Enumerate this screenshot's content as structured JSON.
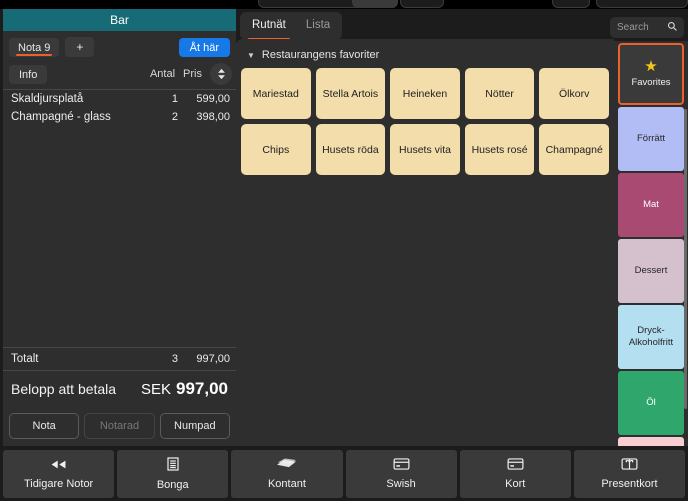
{
  "colors": {
    "header_teal": "#176b77",
    "accent_orange": "#e8622a",
    "primary_blue": "#1778e8",
    "product_tile": "#f2ddab",
    "panel": "#2e2e2e",
    "app_bg": "#1c1c1c"
  },
  "order": {
    "title": "Bar",
    "nota_label": "Nota 9",
    "add_label": "+",
    "eat_here_label": "Åt här",
    "info_label": "Info",
    "sort_icon": "sort-updown-icon",
    "col_qty": "Antal",
    "col_price": "Pris",
    "lines": [
      {
        "name": "Skaldjursplatå",
        "qty": "1",
        "price": "599,00"
      },
      {
        "name": "Champagné - glass",
        "qty": "2",
        "price": "398,00"
      }
    ],
    "total_label": "Totalt",
    "total_qty": "3",
    "total_price": "997,00",
    "amount_label": "Belopp att betala",
    "amount_currency": "SEK",
    "amount_value": "997,00",
    "buttons": [
      {
        "label": "Nota",
        "disabled": false
      },
      {
        "label": "Notarad",
        "disabled": true
      },
      {
        "label": "Numpad",
        "disabled": false
      }
    ]
  },
  "center": {
    "tabs": [
      {
        "label": "Rutnät",
        "active": true
      },
      {
        "label": "Lista",
        "active": false
      }
    ],
    "section_title": "Restaurangens favoriter",
    "caret_icon": "caret-down-icon",
    "products": [
      "Mariestad",
      "Stella Artois",
      "Heineken",
      "Nötter",
      "Ölkorv",
      "Chips",
      "Husets röda",
      "Husets vita",
      "Husets rosé",
      "Champagné"
    ]
  },
  "search": {
    "placeholder": "Search",
    "icon": "search-icon"
  },
  "categories": [
    {
      "label": "Favorites",
      "color": "#3a3a3a",
      "text": "#efefef",
      "selected": true,
      "icon": "star-icon"
    },
    {
      "label": "Förrätt",
      "color": "#b3bdf5",
      "text": "#262626",
      "selected": false
    },
    {
      "label": "Mat",
      "color": "#a94a72",
      "text": "#ffffff",
      "selected": false
    },
    {
      "label": "Dessert",
      "color": "#d5c1ce",
      "text": "#262626",
      "selected": false
    },
    {
      "label": "Dryck-\nAlkoholfritt",
      "color": "#b3dff0",
      "text": "#262626",
      "selected": false
    },
    {
      "label": "Öl",
      "color": "#2fa76c",
      "text": "#ffffff",
      "selected": false
    },
    {
      "label": "",
      "color": "#f7cdd3",
      "text": "#262626",
      "selected": false
    }
  ],
  "bottom_bar": [
    {
      "label": "Tidigare Notor",
      "icon": "rewind-icon"
    },
    {
      "label": "Bonga",
      "icon": "receipt-icon"
    },
    {
      "label": "Kontant",
      "icon": "cash-icon"
    },
    {
      "label": "Swish",
      "icon": "card-icon"
    },
    {
      "label": "Kort",
      "icon": "card-icon"
    },
    {
      "label": "Presentkort",
      "icon": "giftcard-icon"
    }
  ]
}
